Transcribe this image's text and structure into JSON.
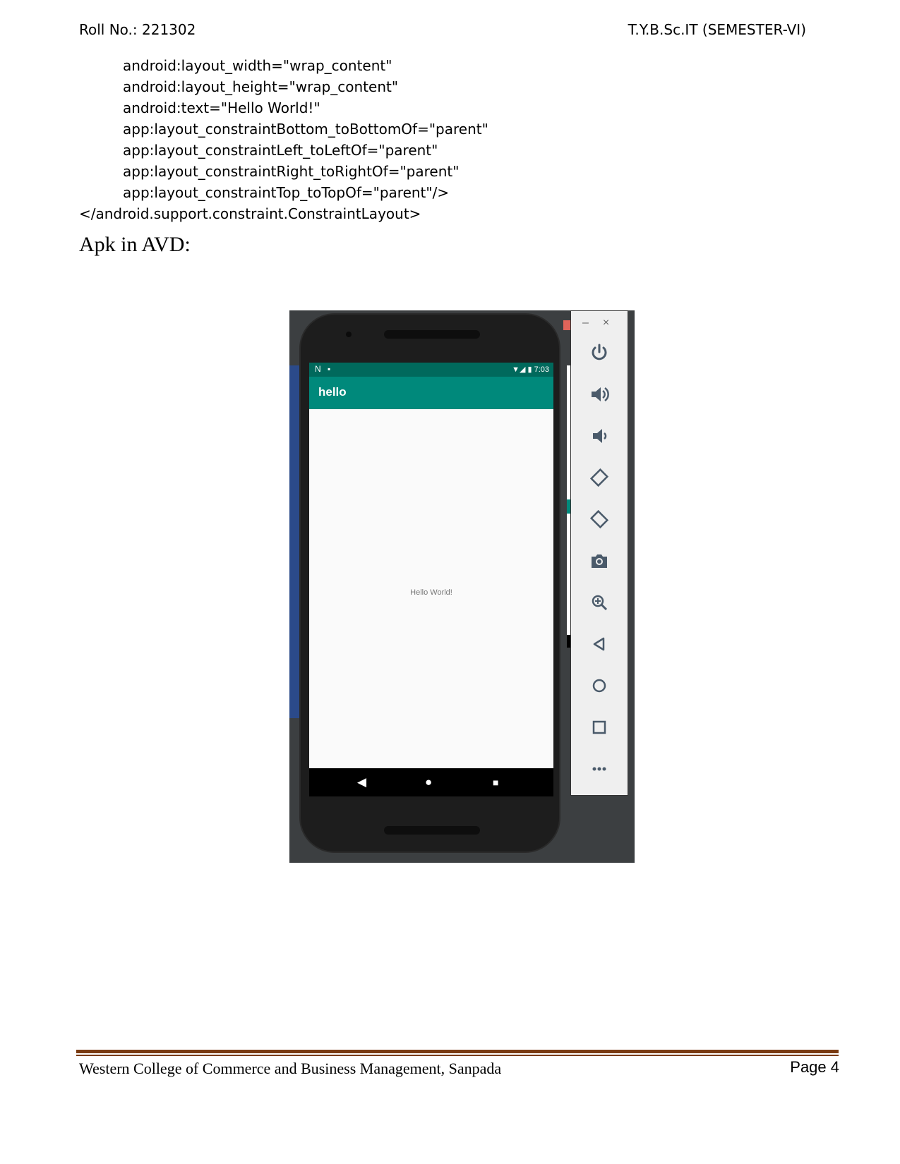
{
  "header": {
    "left": "Roll No.: 221302",
    "right": "T.Y.B.Sc.IT (SEMESTER-VI)"
  },
  "code_lines": [
    "android:layout_width=\"wrap_content\"",
    "android:layout_height=\"wrap_content\"",
    "android:text=\"Hello World!\"",
    "app:layout_constraintBottom_toBottomOf=\"parent\"",
    "app:layout_constraintLeft_toLeftOf=\"parent\"",
    "app:layout_constraintRight_toRightOf=\"parent\"",
    "app:layout_constraintTop_toTopOf=\"parent\"/>",
    "</android.support.constraint.ConstraintLayout>"
  ],
  "section_title": "Apk in AVD:",
  "emulator": {
    "status_time": "7:03",
    "app_title": "hello",
    "content_text": "Hello World!",
    "window_buttons": "–×",
    "toolbar_icons": [
      "power-icon",
      "volume-up-icon",
      "volume-down-icon",
      "rotate-left-icon",
      "rotate-right-icon",
      "camera-icon",
      "zoom-icon",
      "back-icon",
      "home-icon",
      "overview-icon",
      "more-icon"
    ],
    "colors": {
      "status_bar": "#00695c",
      "app_bar": "#00897b"
    }
  },
  "footer": {
    "left": "Western College of Commerce and Business Management, Sanpada",
    "right": "Page 4"
  }
}
